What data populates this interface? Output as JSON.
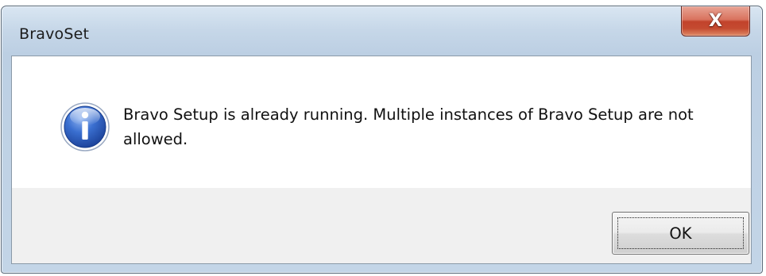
{
  "window": {
    "title": "BravoSet",
    "close_glyph": "X"
  },
  "message": {
    "icon": "info-icon",
    "text": "Bravo Setup is already running. Multiple instances of Bravo Setup are not allowed."
  },
  "buttons": {
    "ok_label": "OK"
  },
  "colors": {
    "titlebar": "#c3d5e7",
    "close_button": "#c7432e",
    "info_icon": "#2458b8",
    "button_face": "#e6e6e6"
  }
}
